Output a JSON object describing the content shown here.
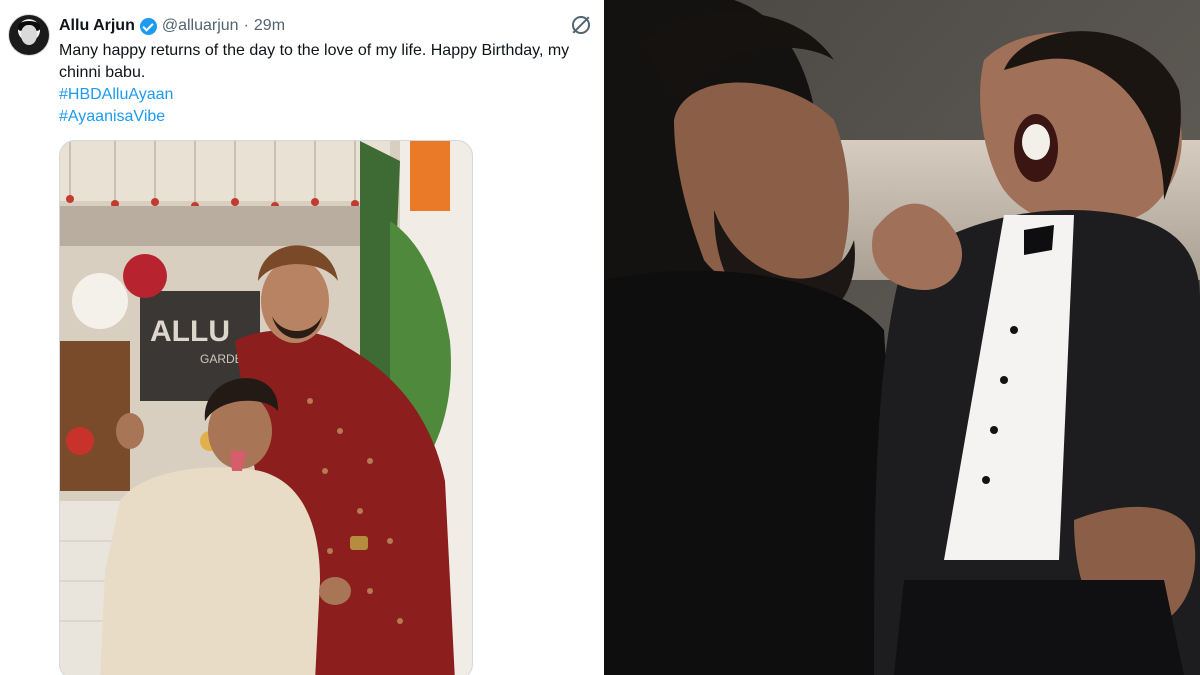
{
  "tweet": {
    "author_name": "Allu Arjun",
    "handle": "@alluarjun",
    "separator": "·",
    "time": "29m",
    "text": "Many happy returns of the day to the love of my life. Happy Birthday, my chinni babu.",
    "hashtags": [
      "#HBDAlluAyaan",
      "#AyaanisaVibe"
    ]
  },
  "media": {
    "sign_text": "ALLU",
    "sign_subtext": "GARDEN"
  },
  "icons": {
    "verified": "verified-badge-icon",
    "grok": "grok-icon",
    "avatar": "avatar"
  },
  "colors": {
    "link": "#1d9bf0",
    "text": "#0f1419",
    "muted": "#536471"
  }
}
